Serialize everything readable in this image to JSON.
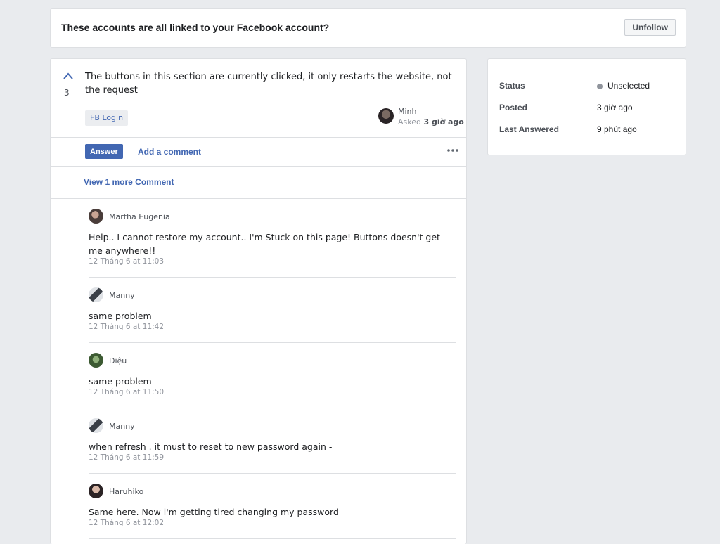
{
  "header": {
    "title": "These accounts are all linked to your Facebook account?",
    "unfollow_label": "Unfollow"
  },
  "question": {
    "vote_count": "3",
    "text": "The buttons in this section are currently clicked, it only restarts the website, not the request",
    "tag": "FB Login",
    "author": "Minh",
    "asked_prefix": "Asked",
    "asked_time": "3 giờ ago",
    "answer_label": "Answer",
    "add_comment_label": "Add a comment",
    "view_more_label": "View 1 more Comment"
  },
  "comments": [
    {
      "author": "Martha Eugenia",
      "text": "Help.. I cannot restore my account.. I'm Stuck on this page! Buttons doesn't get me anywhere!!",
      "time": "12 Tháng 6 at 11:03"
    },
    {
      "author": "Manny",
      "text": "same problem",
      "time": "12 Tháng 6 at 11:42"
    },
    {
      "author": "Diệu",
      "text": "same problem",
      "time": "12 Tháng 6 at 11:50"
    },
    {
      "author": "Manny",
      "text": "when refresh . it must to reset to new password again -",
      "time": "12 Tháng 6 at 11:59"
    },
    {
      "author": "Haruhiko",
      "text": "Same here. Now i'm getting tired changing my password",
      "time": "12 Tháng 6 at 12:02"
    }
  ],
  "status_panel": {
    "status_label": "Status",
    "status_value": "Unselected",
    "posted_label": "Posted",
    "posted_value": "3 giờ ago",
    "last_answered_label": "Last Answered",
    "last_answered_value": "9 phút ago"
  },
  "colors": {
    "accent": "#4267b2",
    "page_background": "#e9ebee",
    "muted_text": "#90949c"
  },
  "icons": {
    "vote_up": "chevron-up-icon",
    "more": "more-horizontal-icon"
  }
}
